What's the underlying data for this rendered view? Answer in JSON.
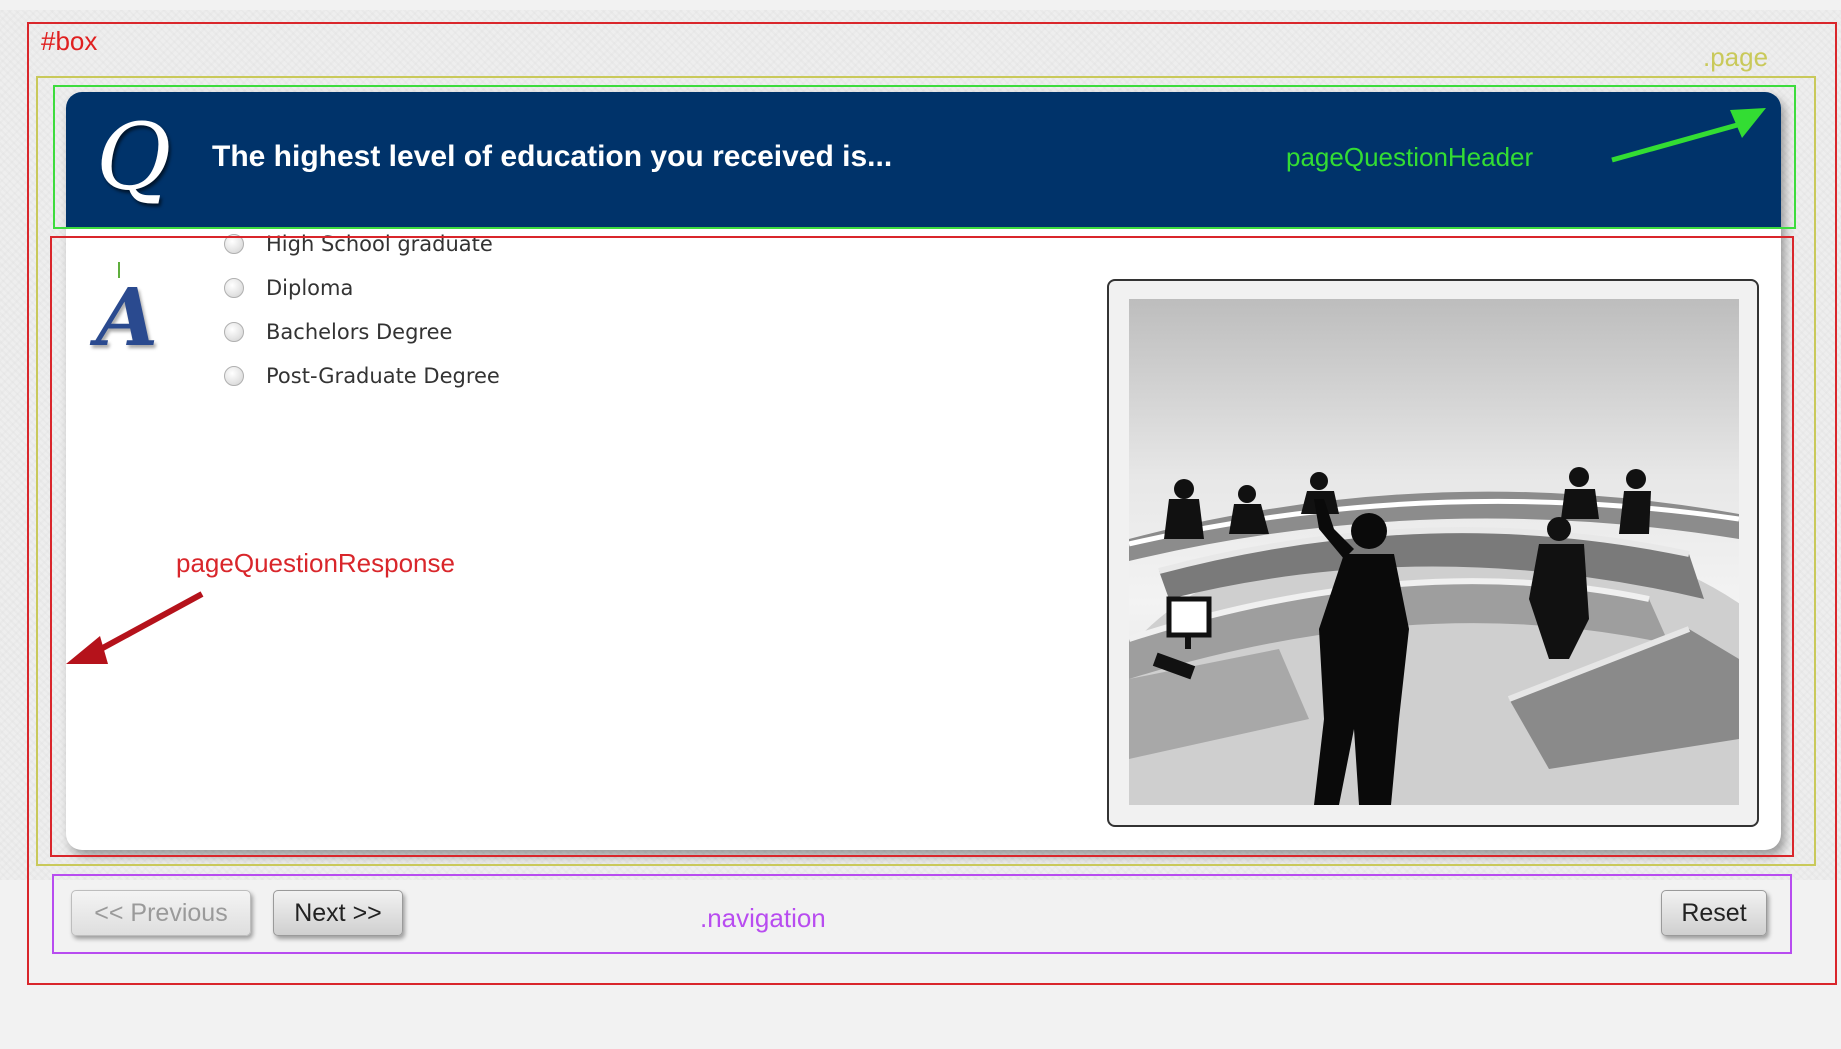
{
  "annotations": {
    "box_label": "#box",
    "page_label": ".page",
    "header_label": "pageQuestionHeader",
    "response_label": "pageQuestionResponse",
    "navigation_label": ".navigation"
  },
  "header": {
    "question": "The highest level of education you received is...",
    "q_icon": "Q"
  },
  "response": {
    "a_icon": "A",
    "options": [
      {
        "label": "High School graduate",
        "selected": false
      },
      {
        "label": "Diploma",
        "selected": false
      },
      {
        "label": "Bachelors Degree",
        "selected": false
      },
      {
        "label": "Post-Graduate Degree",
        "selected": false
      }
    ],
    "image_icon": "lecture-hall-illustration"
  },
  "navigation": {
    "previous_label": "<< Previous",
    "next_label": "Next >>",
    "reset_label": "Reset",
    "previous_disabled": true
  },
  "colors": {
    "header_bg": "#00336a",
    "box_outline": "#d9262b",
    "page_outline": "#c9c95a",
    "header_outline": "#3ddc3d",
    "navigation_outline": "#b84cf0"
  }
}
